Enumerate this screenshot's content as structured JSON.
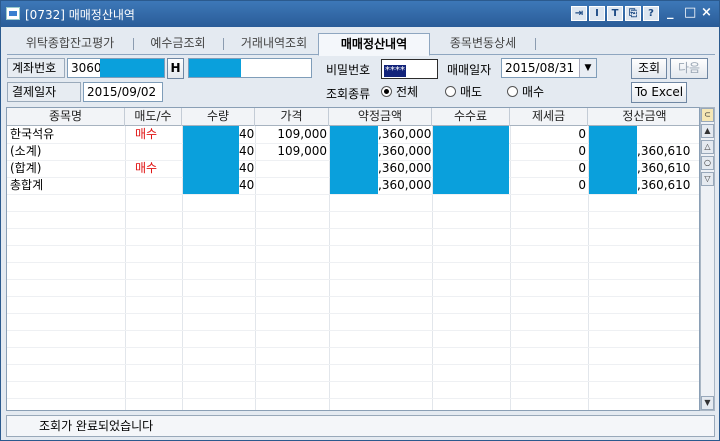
{
  "window": {
    "title": "[0732] 매매정산내역",
    "toolbar_buttons": [
      "⇥",
      "I",
      "T",
      "⎘",
      "?"
    ],
    "controls": {
      "minimize": "_",
      "maximize": "□",
      "close": "×"
    }
  },
  "tabs": [
    {
      "label": "위탁종합잔고평가",
      "active": false
    },
    {
      "label": "예수금조회",
      "active": false
    },
    {
      "label": "거래내역조회",
      "active": false
    },
    {
      "label": "매매정산내역",
      "active": true
    },
    {
      "label": "종목변동상세",
      "active": false
    }
  ],
  "form": {
    "account_label": "계좌번호",
    "account_value": "3060",
    "account_button": "H",
    "password_label": "비밀번호",
    "password_value": "****",
    "trade_date_label": "매매일자",
    "trade_date_value": "2015/08/31",
    "settle_date_label": "결제일자",
    "settle_date_value": "2015/09/02",
    "query_type_label": "조회종류",
    "radio_options": [
      {
        "label": "전체",
        "checked": true
      },
      {
        "label": "매도",
        "checked": false
      },
      {
        "label": "매수",
        "checked": false
      }
    ],
    "query_button": "조회",
    "next_button": "다음",
    "excel_button": "To Excel"
  },
  "table": {
    "columns": [
      "종목명",
      "매도/수",
      "수량",
      "가격",
      "약정금액",
      "수수료",
      "제세금",
      "정산금액"
    ],
    "rows": [
      {
        "name": "한국석유",
        "side": "매수",
        "qty": "40",
        "price": "109,000",
        "amount": ",360,000",
        "fee": "",
        "tax": "0",
        "settle": ""
      },
      {
        "name": "(소계)",
        "side": "",
        "qty": "40",
        "price": "109,000",
        "amount": ",360,000",
        "fee": "",
        "tax": "0",
        "settle": ",360,610"
      },
      {
        "name": "(합계)",
        "side": "매수",
        "qty": "40",
        "price": "",
        "amount": ",360,000",
        "fee": "",
        "tax": "0",
        "settle": ",360,610"
      },
      {
        "name": "총합계",
        "side": "",
        "qty": "40",
        "price": "",
        "amount": ",360,000",
        "fee": "",
        "tax": "0",
        "settle": ",360,610"
      }
    ]
  },
  "status_text": "조회가 완료되었습니다",
  "colors": {
    "titlebar": "#2a5c98",
    "redaction": "#0aa0dc",
    "buy": "#e01010"
  }
}
